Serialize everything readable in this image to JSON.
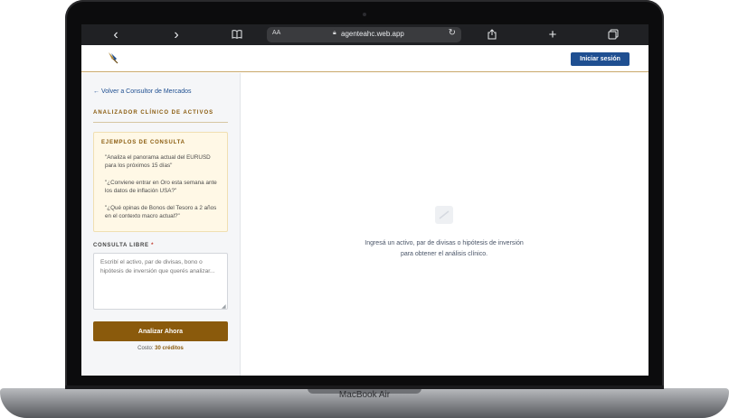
{
  "device": {
    "label": "MacBook Air"
  },
  "browser": {
    "text_size_label": "AA",
    "url": "agenteahc.web.app",
    "back_icon": "‹",
    "forward_icon": "›",
    "bookmarks_icon": "book-icon",
    "share_icon": "share-icon",
    "new_tab_icon": "+",
    "tabs_icon": "tabs-icon"
  },
  "header": {
    "login_label": "Iniciar sesión"
  },
  "sidebar": {
    "back_link": "← Volver a Consultor de Mercados",
    "section_title": "ANALIZADOR CLÍNICO DE ACTIVOS",
    "examples_title": "EJEMPLOS DE CONSULTA",
    "examples": [
      "\"Analiza el panorama actual del EURUSD para los próximos 15 días\"",
      "\"¿Conviene entrar en Oro esta semana ante los datos de inflación USA?\"",
      "\"¿Qué opinas de Bonos del Tesoro a 2 años en el contexto macro actual?\""
    ],
    "query_label": "CONSULTA LIBRE",
    "query_required_mark": "*",
    "query_placeholder": "Escribí el activo, par de divisas, bono o hipótesis de inversión que querés analizar...",
    "analyze_button": "Analizar Ahora",
    "cost_prefix": "Costo:",
    "cost_value": "30 créditos"
  },
  "main": {
    "empty_state_text": "Ingresá un activo, par de divisas o hipótesis de inversión para obtener el análisis clínico."
  },
  "colors": {
    "brand_blue": "#1f4f91",
    "accent_gold": "#8a5a0c",
    "examples_bg": "#fff8e6"
  }
}
